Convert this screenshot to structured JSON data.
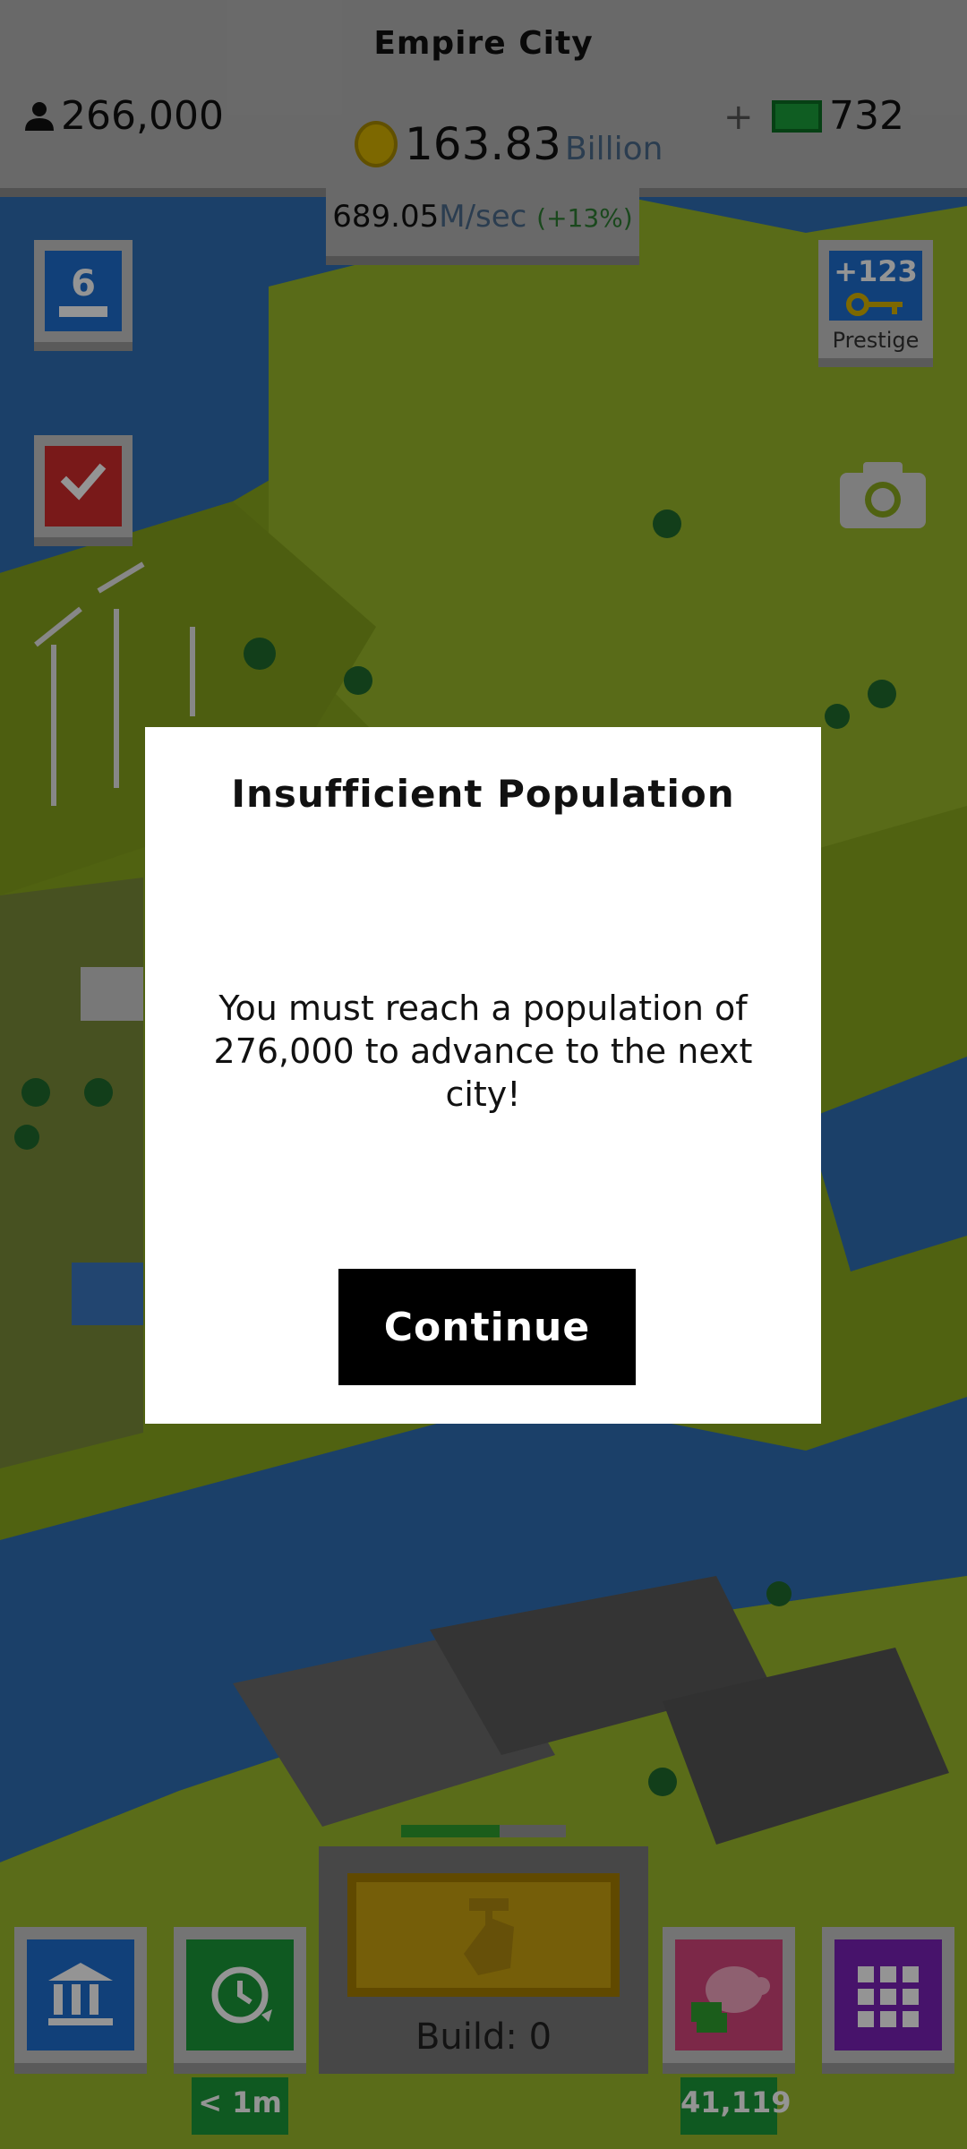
{
  "header": {
    "city_name": "Empire City",
    "population": "266,000",
    "money_value": "163.83",
    "money_unit": "Billion",
    "plus": "+",
    "cash": "732",
    "rate_value": "689.05",
    "rate_unit": "M/sec",
    "rate_pct": "(+13%)"
  },
  "left_tiles": {
    "level": "6"
  },
  "prestige": {
    "value": "+123",
    "label": "Prestige"
  },
  "bottom": {
    "timer_label": "< 1m",
    "build_label": "Build: 0",
    "build_progress": 0.6,
    "piggy_label": "41,119"
  },
  "dialog": {
    "title": "Insufficient Population",
    "message": "You must reach a population of\n276,000  to advance to the next city!",
    "button": "Continue"
  },
  "colors": {
    "grass": "#8fae1f",
    "water": "#2f6fb5",
    "dialog_bg": "#ffffff",
    "button_bg": "#000000"
  }
}
